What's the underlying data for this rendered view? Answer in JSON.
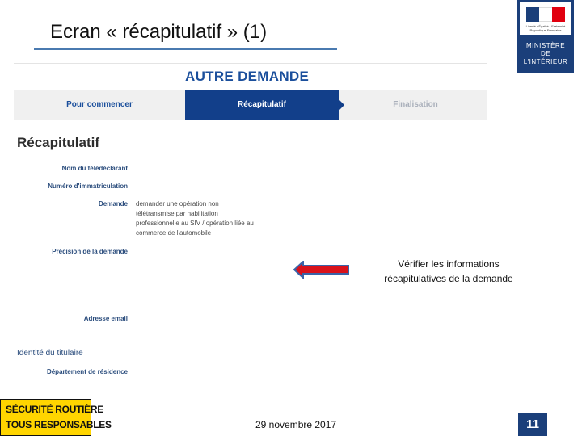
{
  "slide": {
    "title": "Ecran « récapitulatif » (1)",
    "note_line1": "Vérifier les informations",
    "note_line2": "récapitulatives de la demande",
    "date": "29 novembre 2017",
    "page_number": "11"
  },
  "logo": {
    "motto_line1": "Liberté • Égalité • Fraternité",
    "motto_line2": "République Française",
    "ministry_line1": "MINISTÈRE",
    "ministry_line2": "DE",
    "ministry_line3": "L'INTÉRIEUR"
  },
  "form": {
    "heading": "AUTRE DEMANDE",
    "steps": [
      {
        "label": "Pour commencer",
        "active": false
      },
      {
        "label": "Récapitulatif",
        "active": true
      },
      {
        "label": "Finalisation",
        "active": false
      }
    ],
    "section_title": "Récapitulatif",
    "fields": {
      "declarant_name_label": "Nom du télédéclarant",
      "registration_label": "Numéro d'immatriculation",
      "request_label": "Demande",
      "request_value": "demander une opération non télétransmise par habilitation professionnelle au SIV / opération liée au commerce de l'automobile",
      "request_detail_label": "Précision de la demande",
      "email_label": "Adresse email",
      "holder_title": "Identité du titulaire",
      "department_label": "Département de résidence"
    }
  },
  "securite_routiere": {
    "line1": "SÉCURITÉ ROUTIÈRE",
    "line2": "TOUS RESPONSABLES"
  },
  "colors": {
    "accent_blue": "#1b3f7a",
    "step_active": "#123f8a",
    "arrow_red": "#d9121b",
    "arrow_outline": "#3a63a8",
    "sr_yellow": "#ffd500"
  }
}
